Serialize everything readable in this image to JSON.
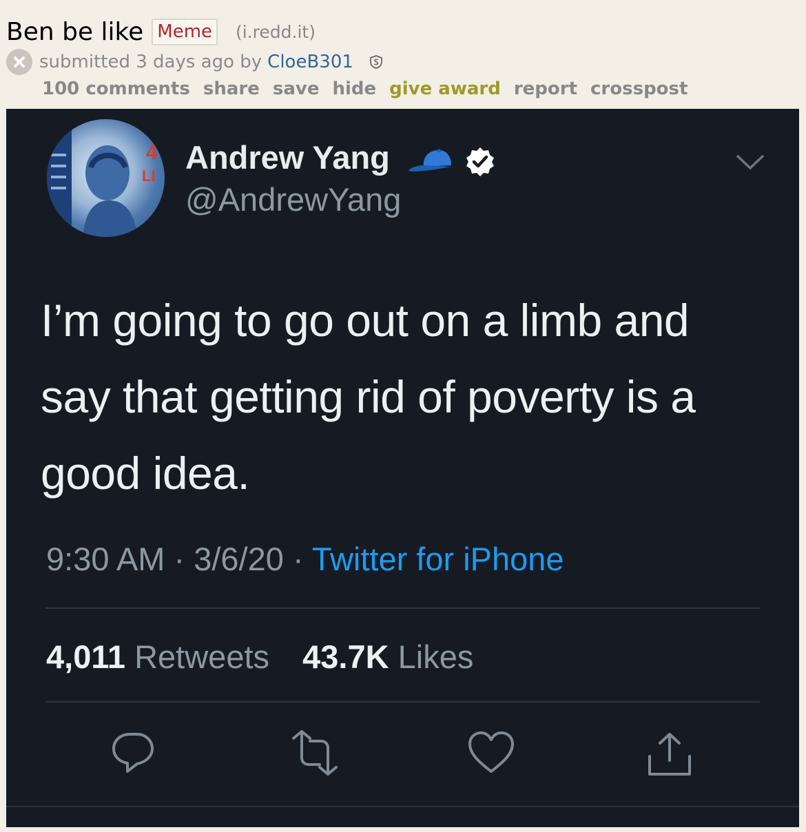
{
  "post": {
    "title": "Ben be like",
    "flair": "Meme",
    "domain": "(i.redd.it)",
    "submitted_text": "submitted 3 days ago by",
    "author": "CloeB301"
  },
  "actions": {
    "comments": "100 comments",
    "share": "share",
    "save": "save",
    "hide": "hide",
    "give_award": "give award",
    "report": "report",
    "crosspost": "crosspost"
  },
  "tweet": {
    "display_name": "Andrew Yang",
    "handle": "@AndrewYang",
    "line1": "I’m going to go out on a limb and",
    "line2": "say that getting rid of poverty is a",
    "line3": "good idea.",
    "time": "9:30 AM",
    "date": "3/6/20",
    "sep": " · ",
    "source": "Twitter for iPhone",
    "retweets_count": "4,011",
    "retweets_label": "Retweets",
    "likes_count": "43.7K",
    "likes_label": "Likes",
    "avatar_text": "4 LI"
  },
  "colors": {
    "page_bg": "#f3efe6",
    "tweet_bg": "#161b23",
    "link_blue": "#336699",
    "twitter_blue": "#1d9bf0",
    "award_gold": "#9d9a2a",
    "flair_red": "#b5242a"
  },
  "icons": [
    "remove-icon",
    "mod-shield-icon",
    "cap-icon",
    "verified-icon",
    "chevron-down-icon",
    "reply-icon",
    "retweet-icon",
    "like-icon",
    "share-icon"
  ]
}
